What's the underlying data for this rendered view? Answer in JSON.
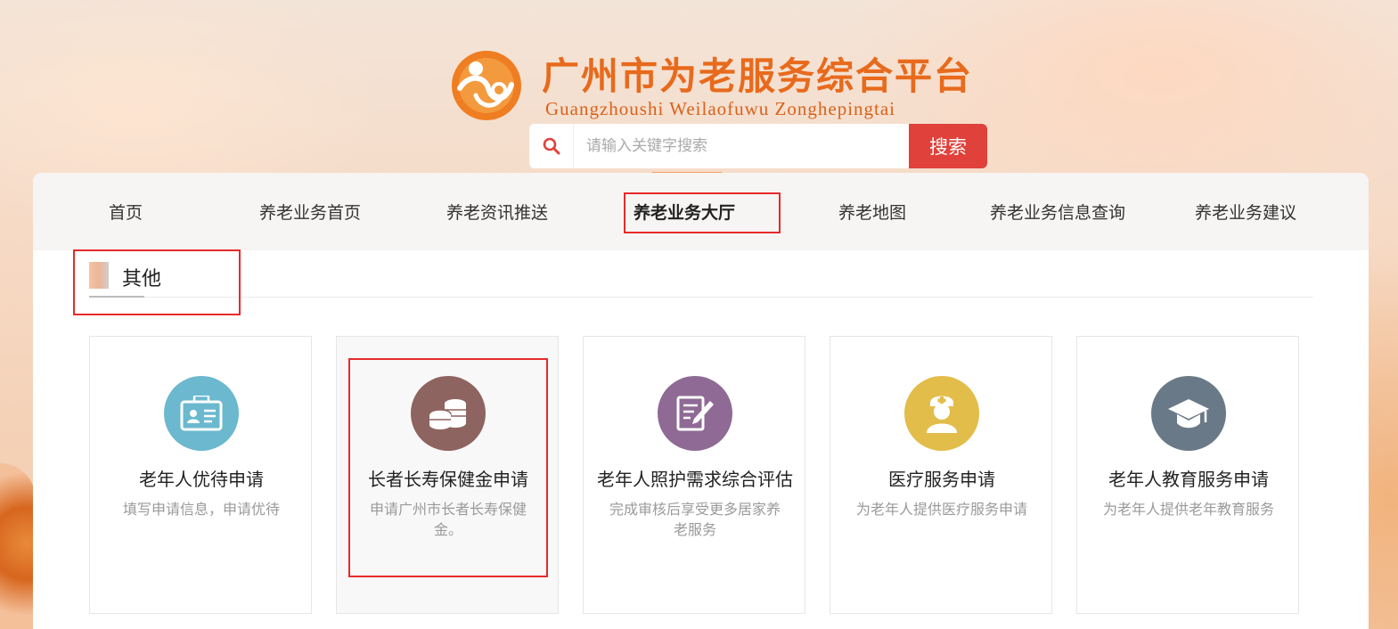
{
  "header": {
    "title": "广州市为老服务综合平台",
    "subtitle": "Guangzhoushi Weilaofuwu Zonghepingtai",
    "logo_icon": "logo-icon"
  },
  "search": {
    "placeholder": "请输入关键字搜索",
    "button_label": "搜索",
    "icon": "search-icon"
  },
  "nav": {
    "items": [
      {
        "label": "首页"
      },
      {
        "label": "养老业务首页"
      },
      {
        "label": "养老资讯推送"
      },
      {
        "label": "养老业务大厅",
        "active": true
      },
      {
        "label": "养老地图"
      },
      {
        "label": "养老业务信息查询"
      },
      {
        "label": "养老业务建议"
      }
    ]
  },
  "section": {
    "title": "其他"
  },
  "cards": [
    {
      "title": "老年人优待申请",
      "desc": "填写申请信息，申请优待",
      "icon": "id-card-icon",
      "color": "#6bb8cf"
    },
    {
      "title": "长者长寿保健金申请",
      "desc": "申请广州市长者长寿保健金。",
      "icon": "coins-icon",
      "color": "#8e6460"
    },
    {
      "title": "老年人照护需求综合评估",
      "desc": "完成审核后享受更多居家养老服务",
      "icon": "edit-document-icon",
      "color": "#8f6a95"
    },
    {
      "title": "医疗服务申请",
      "desc": "为老年人提供医疗服务申请",
      "icon": "nurse-icon",
      "color": "#e2bd4a"
    },
    {
      "title": "老年人教育服务申请",
      "desc": "为老年人提供老年教育服务",
      "icon": "graduation-cap-icon",
      "color": "#6a7987"
    }
  ],
  "colors": {
    "accent": "#e86a1c",
    "search_button": "#e0413a",
    "highlight_box": "#e62a2a"
  }
}
